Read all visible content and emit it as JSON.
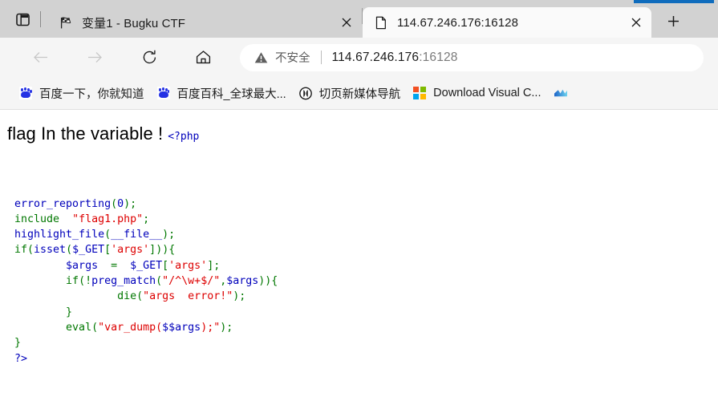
{
  "window": {
    "tab_actions_icon": "vertical-tabs-icon",
    "new_tab_label": "+"
  },
  "tabs": [
    {
      "title": "变量1 - Bugku CTF",
      "favicon": "checkered-flag-icon",
      "active": false,
      "close_label": "✕"
    },
    {
      "title": "114.67.246.176:16128",
      "favicon": "blank-page-icon",
      "active": true,
      "close_label": "✕"
    }
  ],
  "toolbar": {
    "back_icon": "arrow-left-icon",
    "forward_icon": "arrow-right-icon",
    "reload_icon": "reload-icon",
    "home_icon": "home-icon",
    "security_icon": "warning-triangle-icon",
    "security_text": "不安全",
    "url_host": "114.67.246.176",
    "url_port": ":16128"
  },
  "bookmarks": [
    {
      "label": "百度一下，你就知道",
      "icon": "baidu-paw-icon"
    },
    {
      "label": "百度百科_全球最大...",
      "icon": "baidu-paw-icon"
    },
    {
      "label": "切页新媒体导航",
      "icon": "qieye-circle-icon"
    },
    {
      "label": "Download Visual C...",
      "icon": "microsoft-squares-icon"
    },
    {
      "label": "",
      "icon": "blue-gradient-icon"
    }
  ],
  "page": {
    "heading": "flag In the variable !",
    "php_open_tag": "<?php",
    "code_lines": [
      [
        {
          "t": "\n",
          "c": "kw"
        }
      ],
      [
        {
          "t": "error_reporting",
          "c": "fn"
        },
        {
          "t": "(",
          "c": "kw"
        },
        {
          "t": "0",
          "c": "fn"
        },
        {
          "t": ")",
          "c": "kw"
        },
        {
          "t": ";",
          "c": "kw"
        }
      ],
      [
        {
          "t": "include",
          "c": "kw"
        },
        {
          "t": "  ",
          "c": "kw"
        },
        {
          "t": "\"flag1.php\"",
          "c": "str"
        },
        {
          "t": ";",
          "c": "kw"
        }
      ],
      [
        {
          "t": "highlight_file",
          "c": "fn"
        },
        {
          "t": "(",
          "c": "kw"
        },
        {
          "t": "__file__",
          "c": "fn"
        },
        {
          "t": ")",
          "c": "kw"
        },
        {
          "t": ";",
          "c": "kw"
        }
      ],
      [
        {
          "t": "if",
          "c": "kw"
        },
        {
          "t": "(",
          "c": "kw"
        },
        {
          "t": "isset",
          "c": "fn"
        },
        {
          "t": "(",
          "c": "kw"
        },
        {
          "t": "$_GET",
          "c": "fn"
        },
        {
          "t": "[",
          "c": "kw"
        },
        {
          "t": "'args'",
          "c": "str"
        },
        {
          "t": "]",
          "c": "kw"
        },
        {
          "t": "))",
          "c": "kw"
        },
        {
          "t": "{",
          "c": "kw"
        }
      ],
      [
        {
          "t": "        ",
          "c": "kw"
        },
        {
          "t": "$args",
          "c": "fn"
        },
        {
          "t": "  =  ",
          "c": "kw"
        },
        {
          "t": "$_GET",
          "c": "fn"
        },
        {
          "t": "[",
          "c": "kw"
        },
        {
          "t": "'args'",
          "c": "str"
        },
        {
          "t": "]",
          "c": "kw"
        },
        {
          "t": ";",
          "c": "kw"
        }
      ],
      [
        {
          "t": "        ",
          "c": "kw"
        },
        {
          "t": "if",
          "c": "kw"
        },
        {
          "t": "(!",
          "c": "kw"
        },
        {
          "t": "preg_match",
          "c": "fn"
        },
        {
          "t": "(",
          "c": "kw"
        },
        {
          "t": "\"/^\\w+$/\"",
          "c": "str"
        },
        {
          "t": ",",
          "c": "kw"
        },
        {
          "t": "$args",
          "c": "fn"
        },
        {
          "t": "))",
          "c": "kw"
        },
        {
          "t": "{",
          "c": "kw"
        }
      ],
      [
        {
          "t": "                ",
          "c": "kw"
        },
        {
          "t": "die",
          "c": "kw"
        },
        {
          "t": "(",
          "c": "kw"
        },
        {
          "t": "\"args  error!\"",
          "c": "str"
        },
        {
          "t": ")",
          "c": "kw"
        },
        {
          "t": ";",
          "c": "kw"
        }
      ],
      [
        {
          "t": "        ",
          "c": "kw"
        },
        {
          "t": "}",
          "c": "kw"
        }
      ],
      [
        {
          "t": "        ",
          "c": "kw"
        },
        {
          "t": "eval",
          "c": "kw"
        },
        {
          "t": "(",
          "c": "kw"
        },
        {
          "t": "\"var_dump(",
          "c": "str"
        },
        {
          "t": "$$args",
          "c": "fn"
        },
        {
          "t": ");\"",
          "c": "str"
        },
        {
          "t": ")",
          "c": "kw"
        },
        {
          "t": ";",
          "c": "kw"
        }
      ],
      [
        {
          "t": "}",
          "c": "kw"
        }
      ],
      [
        {
          "t": "?>",
          "c": "tag"
        }
      ]
    ]
  },
  "colors": {
    "php_keyword": "#007700",
    "php_function": "#0000bb",
    "php_string": "#dd0000",
    "tab_active_bg": "#fafafa",
    "tab_strip_bg": "#d2d2d2",
    "toolbar_bg": "#f5f5f5",
    "accent_blue": "#0f6cbd"
  }
}
